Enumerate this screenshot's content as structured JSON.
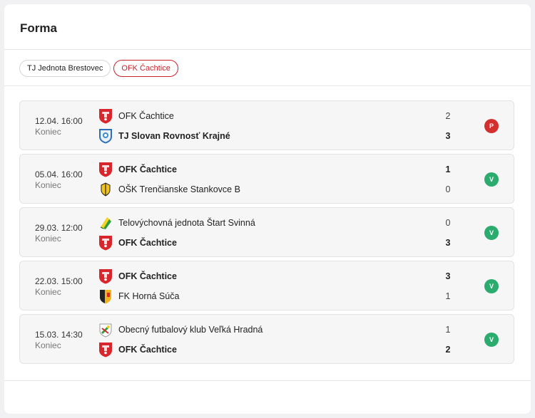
{
  "widget": {
    "title": "Forma"
  },
  "tabs": [
    {
      "label": "TJ Jednota Brestovec",
      "active": false
    },
    {
      "label": "OFK Čachtice",
      "active": true
    }
  ],
  "colors": {
    "win": "#2bab6e",
    "loss": "#d32f2f",
    "accent": "#c8232c"
  },
  "matches": [
    {
      "date": "12.04. 16:00",
      "status": "Koniec",
      "home": {
        "name": "OFK Čachtice",
        "score": "2",
        "crest": "cachtice-crest-icon",
        "bold": false
      },
      "away": {
        "name": "TJ Slovan Rovnosť Krajné",
        "score": "3",
        "crest": "krajne-crest-icon",
        "bold": true
      },
      "result": "P",
      "result_type": "loss"
    },
    {
      "date": "05.04. 16:00",
      "status": "Koniec",
      "home": {
        "name": "OFK Čachtice",
        "score": "1",
        "crest": "cachtice-crest-icon",
        "bold": true
      },
      "away": {
        "name": "OŠK Trenčianske Stankovce B",
        "score": "0",
        "crest": "stankovce-crest-icon",
        "bold": false
      },
      "result": "V",
      "result_type": "win"
    },
    {
      "date": "29.03. 12:00",
      "status": "Koniec",
      "home": {
        "name": "Telovýchovná jednota Štart Svinná",
        "score": "0",
        "crest": "svinna-crest-icon",
        "bold": false
      },
      "away": {
        "name": "OFK Čachtice",
        "score": "3",
        "crest": "cachtice-crest-icon",
        "bold": true
      },
      "result": "V",
      "result_type": "win"
    },
    {
      "date": "22.03. 15:00",
      "status": "Koniec",
      "home": {
        "name": "OFK Čachtice",
        "score": "3",
        "crest": "cachtice-crest-icon",
        "bold": true
      },
      "away": {
        "name": "FK Horná Súča",
        "score": "1",
        "crest": "horna-suca-crest-icon",
        "bold": false
      },
      "result": "V",
      "result_type": "win"
    },
    {
      "date": "15.03. 14:30",
      "status": "Koniec",
      "home": {
        "name": "Obecný futbalový klub Veľká Hradná",
        "score": "1",
        "crest": "velka-hradna-crest-icon",
        "bold": false
      },
      "away": {
        "name": "OFK Čachtice",
        "score": "2",
        "crest": "cachtice-crest-icon",
        "bold": true
      },
      "result": "V",
      "result_type": "win"
    }
  ]
}
